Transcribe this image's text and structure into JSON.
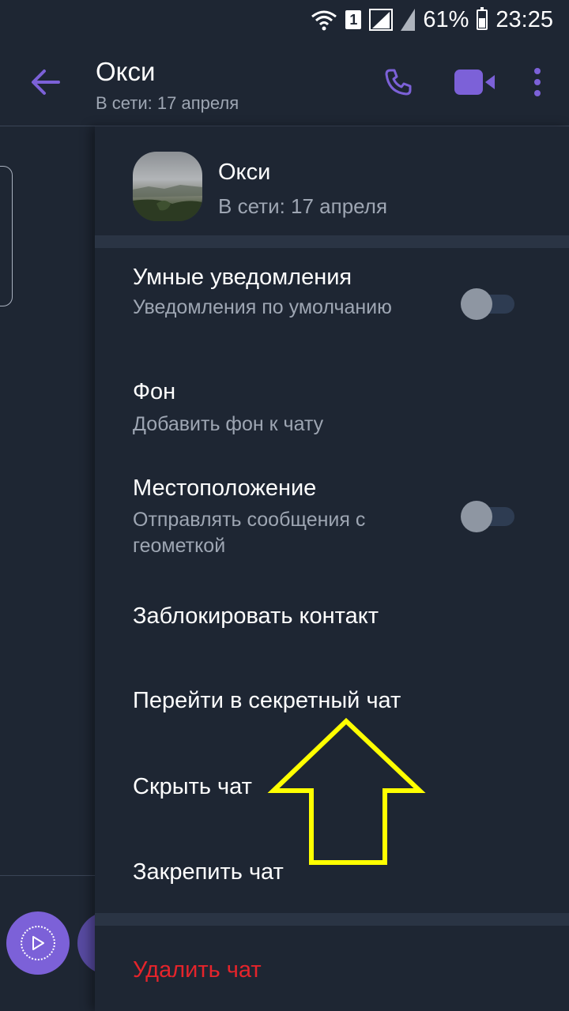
{
  "status_bar": {
    "sim": "1",
    "battery": "61%",
    "battery_level": 0.61,
    "time": "23:25"
  },
  "header": {
    "title": "Окси",
    "subtitle": "В сети: 17 апреля",
    "icons": [
      "back-arrow-icon",
      "phone-icon",
      "video-camera-icon",
      "more-vert-icon"
    ],
    "accent_color": "#7c61d8"
  },
  "contact": {
    "name": "Окси",
    "status": "В сети: 17 апреля"
  },
  "settings": {
    "smart_notifications": {
      "title": "Умные уведомления",
      "subtitle": "Уведомления по умолчанию",
      "enabled": false
    },
    "background": {
      "title": "Фон",
      "subtitle": "Добавить фон к чату"
    },
    "location": {
      "title": "Местоположение",
      "subtitle": "Отправлять сообщения с геометкой",
      "enabled": false
    },
    "block": {
      "title": "Заблокировать контакт"
    },
    "secret_chat": {
      "title": "Перейти в секретный чат"
    },
    "hide_chat": {
      "title": "Скрыть чат"
    },
    "pin_chat": {
      "title": "Закрепить чат"
    },
    "delete_chat": {
      "title": "Удалить чат",
      "color": "#e5242b"
    }
  },
  "annotation": {
    "arrow_color": "#ffff00"
  }
}
